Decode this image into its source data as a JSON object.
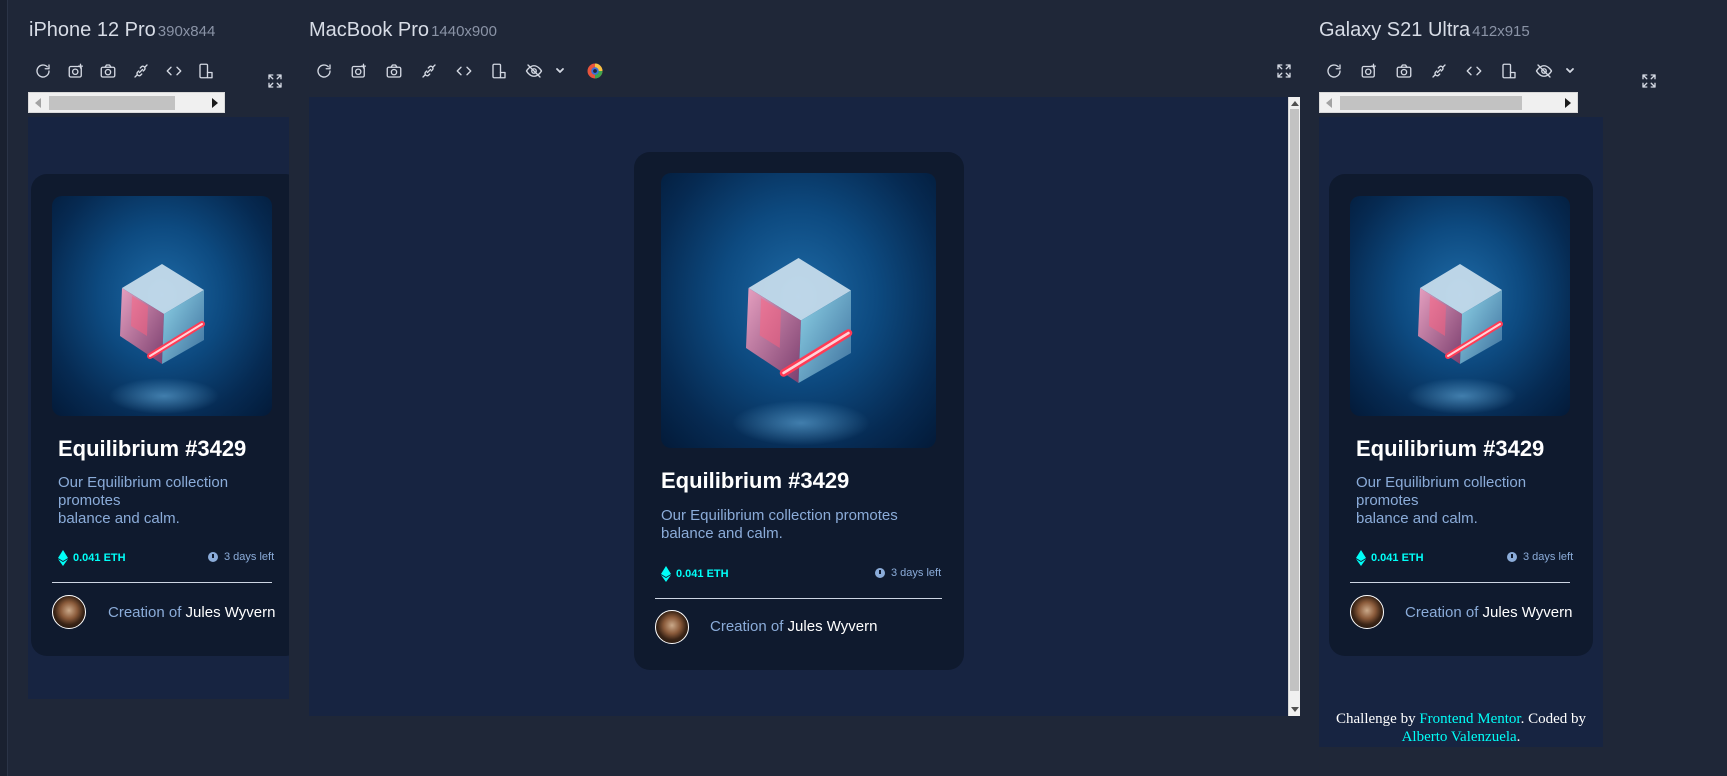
{
  "devices": [
    {
      "name": "iPhone 12 Pro",
      "size": "390x844"
    },
    {
      "name": "MacBook Pro",
      "size": "1440x900"
    },
    {
      "name": "Galaxy S21 Ultra",
      "size": "412x915"
    }
  ],
  "toolbar_icons": [
    "refresh-icon",
    "screenshot-viewport-icon",
    "camera-icon",
    "link-icon",
    "code-icon",
    "rotate-device-icon",
    "hide-icon",
    "chevron-down-icon",
    "color-picker-icon"
  ],
  "card": {
    "title": "Equilibrium #3429",
    "description": "Our Equilibrium collection promotes balance and calm.",
    "description_narrow_lines": [
      "Our Equilibrium collection",
      "promotes",
      "balance and calm."
    ],
    "price": "0.041 ETH",
    "time_left": "3 days left",
    "creation_prefix": "Creation of",
    "creator_name": "Jules Wyvern"
  },
  "attribution": {
    "prefix": "Challenge by",
    "mentor_link": "Frontend Mentor",
    "middle": ". Coded by",
    "author_link": "Alberto Valenzuela",
    "suffix": "."
  },
  "colors": {
    "page_bg": "#1f2738",
    "viewport_bg": "#172441",
    "card_bg": "#0f1a2e",
    "accent_cyan": "#00fff8",
    "soft_blue": "#8bacd9"
  }
}
